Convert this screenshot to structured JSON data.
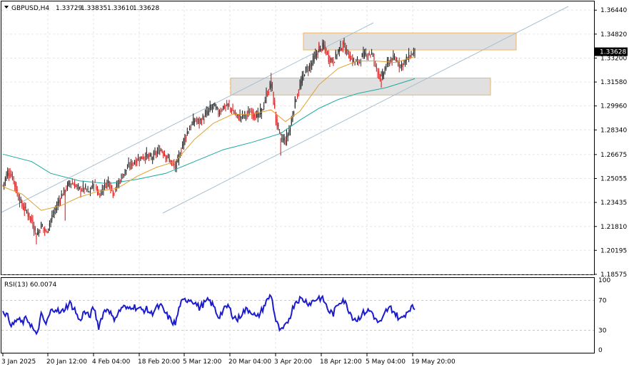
{
  "chart_data": {
    "type": "candlestick",
    "symbol_label": "GBPUSD,H4",
    "ohlc_header": [
      "1.33729",
      "1.33835",
      "1.33610",
      "1.33628"
    ],
    "current_price_label": "1.33628",
    "price_ticks": [
      "1.36440",
      "1.34820",
      "1.33200",
      "1.31580",
      "1.29960",
      "1.28340",
      "1.26675",
      "1.25055",
      "1.23435",
      "1.21810",
      "1.20195",
      "1.18575"
    ],
    "ylim": [
      1.1857,
      1.3703
    ],
    "time_ticks": [
      "3 Jan 2025",
      "20 Jan 12:00",
      "4 Feb 04:00",
      "18 Feb 20:00",
      "5 Mar 12:00",
      "20 Mar 04:00",
      "3 Apr 20:00",
      "18 Apr 12:00",
      "5 May 04:00",
      "19 May 20:00"
    ],
    "grid": true,
    "price_path": [
      [
        0,
        1.246
      ],
      [
        1,
        1.255
      ],
      [
        2,
        1.252
      ],
      [
        3,
        1.24
      ],
      [
        4,
        1.232
      ],
      [
        5,
        1.228
      ],
      [
        6,
        1.222
      ],
      [
        7,
        1.212
      ],
      [
        8,
        1.219
      ],
      [
        9,
        1.214
      ],
      [
        10,
        1.223
      ],
      [
        11,
        1.23
      ],
      [
        12,
        1.238
      ],
      [
        13,
        1.243
      ],
      [
        14,
        1.248
      ],
      [
        15,
        1.246
      ],
      [
        16,
        1.243
      ],
      [
        17,
        1.244
      ],
      [
        18,
        1.241
      ],
      [
        19,
        1.248
      ],
      [
        20,
        1.239
      ],
      [
        21,
        1.245
      ],
      [
        22,
        1.249
      ],
      [
        23,
        1.241
      ],
      [
        24,
        1.247
      ],
      [
        25,
        1.253
      ],
      [
        26,
        1.258
      ],
      [
        27,
        1.261
      ],
      [
        28,
        1.263
      ],
      [
        29,
        1.265
      ],
      [
        30,
        1.266
      ],
      [
        31,
        1.264
      ],
      [
        32,
        1.268
      ],
      [
        33,
        1.27
      ],
      [
        34,
        1.266
      ],
      [
        35,
        1.262
      ],
      [
        36,
        1.258
      ],
      [
        37,
        1.268
      ],
      [
        38,
        1.279
      ],
      [
        39,
        1.285
      ],
      [
        40,
        1.29
      ],
      [
        41,
        1.289
      ],
      [
        42,
        1.292
      ],
      [
        43,
        1.297
      ],
      [
        44,
        1.3
      ],
      [
        45,
        1.295
      ],
      [
        46,
        1.299
      ],
      [
        47,
        1.3
      ],
      [
        48,
        1.296
      ],
      [
        49,
        1.292
      ],
      [
        50,
        1.293
      ],
      [
        51,
        1.294
      ],
      [
        52,
        1.296
      ],
      [
        53,
        1.292
      ],
      [
        54,
        1.296
      ],
      [
        55,
        1.307
      ],
      [
        56,
        1.315
      ],
      [
        57,
        1.29
      ],
      [
        58,
        1.278
      ],
      [
        59,
        1.276
      ],
      [
        60,
        1.286
      ],
      [
        61,
        1.303
      ],
      [
        62,
        1.313
      ],
      [
        63,
        1.323
      ],
      [
        64,
        1.326
      ],
      [
        65,
        1.332
      ],
      [
        66,
        1.338
      ],
      [
        67,
        1.34
      ],
      [
        68,
        1.332
      ],
      [
        69,
        1.33
      ],
      [
        70,
        1.337
      ],
      [
        71,
        1.341
      ],
      [
        72,
        1.335
      ],
      [
        73,
        1.33
      ],
      [
        74,
        1.329
      ],
      [
        75,
        1.333
      ],
      [
        76,
        1.335
      ],
      [
        77,
        1.335
      ],
      [
        78,
        1.325
      ],
      [
        79,
        1.318
      ],
      [
        80,
        1.327
      ],
      [
        81,
        1.331
      ],
      [
        82,
        1.331
      ],
      [
        83,
        1.327
      ],
      [
        84,
        1.33
      ],
      [
        85,
        1.334
      ],
      [
        86,
        1.336
      ]
    ],
    "extra_lows": [
      [
        7,
        1.206
      ],
      [
        13,
        1.222
      ],
      [
        58,
        1.266
      ],
      [
        79,
        1.312
      ]
    ],
    "extra_highs": [
      [
        56,
        1.322
      ],
      [
        66,
        1.343
      ],
      [
        71,
        1.344
      ]
    ],
    "ma_fast": [
      [
        0,
        1.245
      ],
      [
        4,
        1.24
      ],
      [
        8,
        1.229
      ],
      [
        12,
        1.232
      ],
      [
        16,
        1.238
      ],
      [
        20,
        1.242
      ],
      [
        24,
        1.244
      ],
      [
        28,
        1.252
      ],
      [
        32,
        1.258
      ],
      [
        36,
        1.262
      ],
      [
        40,
        1.277
      ],
      [
        44,
        1.288
      ],
      [
        48,
        1.294
      ],
      [
        52,
        1.294
      ],
      [
        56,
        1.297
      ],
      [
        59,
        1.289
      ],
      [
        62,
        1.296
      ],
      [
        66,
        1.314
      ],
      [
        70,
        1.325
      ],
      [
        74,
        1.33
      ],
      [
        78,
        1.33
      ],
      [
        82,
        1.329
      ],
      [
        86,
        1.333
      ]
    ],
    "ma_slow": [
      [
        0,
        1.267
      ],
      [
        6,
        1.262
      ],
      [
        10,
        1.254
      ],
      [
        16,
        1.249
      ],
      [
        22,
        1.247
      ],
      [
        28,
        1.25
      ],
      [
        34,
        1.254
      ],
      [
        40,
        1.262
      ],
      [
        46,
        1.27
      ],
      [
        52,
        1.275
      ],
      [
        58,
        1.281
      ],
      [
        62,
        1.29
      ],
      [
        66,
        1.298
      ],
      [
        70,
        1.304
      ],
      [
        74,
        1.308
      ],
      [
        80,
        1.312
      ],
      [
        86,
        1.318
      ]
    ],
    "channel_upper": [
      [
        0,
        1.232
      ],
      [
        135,
        1.369
      ]
    ],
    "channel_lower": [
      [
        39,
        1.232
      ],
      [
        135,
        1.369
      ]
    ],
    "resistance_zone": [
      1.3375,
      1.349
    ],
    "support_zone": [
      1.307,
      1.3185
    ],
    "rsi": {
      "label": "RSI(13) 60.0074",
      "levels": [
        "100",
        "70",
        "30",
        "0"
      ],
      "ylim": [
        0,
        100
      ],
      "path": [
        [
          0,
          58
        ],
        [
          1,
          48
        ],
        [
          2,
          36
        ],
        [
          3,
          45
        ],
        [
          4,
          40
        ],
        [
          5,
          46
        ],
        [
          6,
          36
        ],
        [
          7,
          22
        ],
        [
          8,
          50
        ],
        [
          9,
          38
        ],
        [
          10,
          55
        ],
        [
          11,
          60
        ],
        [
          12,
          52
        ],
        [
          13,
          60
        ],
        [
          14,
          66
        ],
        [
          15,
          58
        ],
        [
          16,
          42
        ],
        [
          17,
          55
        ],
        [
          18,
          48
        ],
        [
          19,
          60
        ],
        [
          20,
          35
        ],
        [
          21,
          54
        ],
        [
          22,
          60
        ],
        [
          23,
          45
        ],
        [
          24,
          52
        ],
        [
          25,
          62
        ],
        [
          26,
          58
        ],
        [
          27,
          63
        ],
        [
          28,
          60
        ],
        [
          29,
          57
        ],
        [
          30,
          58
        ],
        [
          31,
          52
        ],
        [
          32,
          60
        ],
        [
          33,
          62
        ],
        [
          34,
          52
        ],
        [
          35,
          44
        ],
        [
          36,
          38
        ],
        [
          37,
          65
        ],
        [
          38,
          70
        ],
        [
          39,
          72
        ],
        [
          40,
          68
        ],
        [
          41,
          60
        ],
        [
          42,
          66
        ],
        [
          43,
          70
        ],
        [
          44,
          62
        ],
        [
          45,
          48
        ],
        [
          46,
          56
        ],
        [
          47,
          63
        ],
        [
          48,
          50
        ],
        [
          49,
          44
        ],
        [
          50,
          54
        ],
        [
          51,
          58
        ],
        [
          52,
          55
        ],
        [
          53,
          46
        ],
        [
          54,
          56
        ],
        [
          55,
          68
        ],
        [
          56,
          78
        ],
        [
          57,
          42
        ],
        [
          58,
          28
        ],
        [
          59,
          35
        ],
        [
          60,
          50
        ],
        [
          61,
          68
        ],
        [
          62,
          72
        ],
        [
          63,
          70
        ],
        [
          64,
          66
        ],
        [
          65,
          70
        ],
        [
          66,
          74
        ],
        [
          67,
          70
        ],
        [
          68,
          56
        ],
        [
          69,
          52
        ],
        [
          70,
          66
        ],
        [
          71,
          72
        ],
        [
          72,
          60
        ],
        [
          73,
          48
        ],
        [
          74,
          44
        ],
        [
          75,
          52
        ],
        [
          76,
          56
        ],
        [
          77,
          55
        ],
        [
          78,
          42
        ],
        [
          79,
          40
        ],
        [
          80,
          56
        ],
        [
          81,
          60
        ],
        [
          82,
          52
        ],
        [
          83,
          44
        ],
        [
          84,
          52
        ],
        [
          85,
          60
        ],
        [
          86,
          60
        ]
      ]
    }
  }
}
